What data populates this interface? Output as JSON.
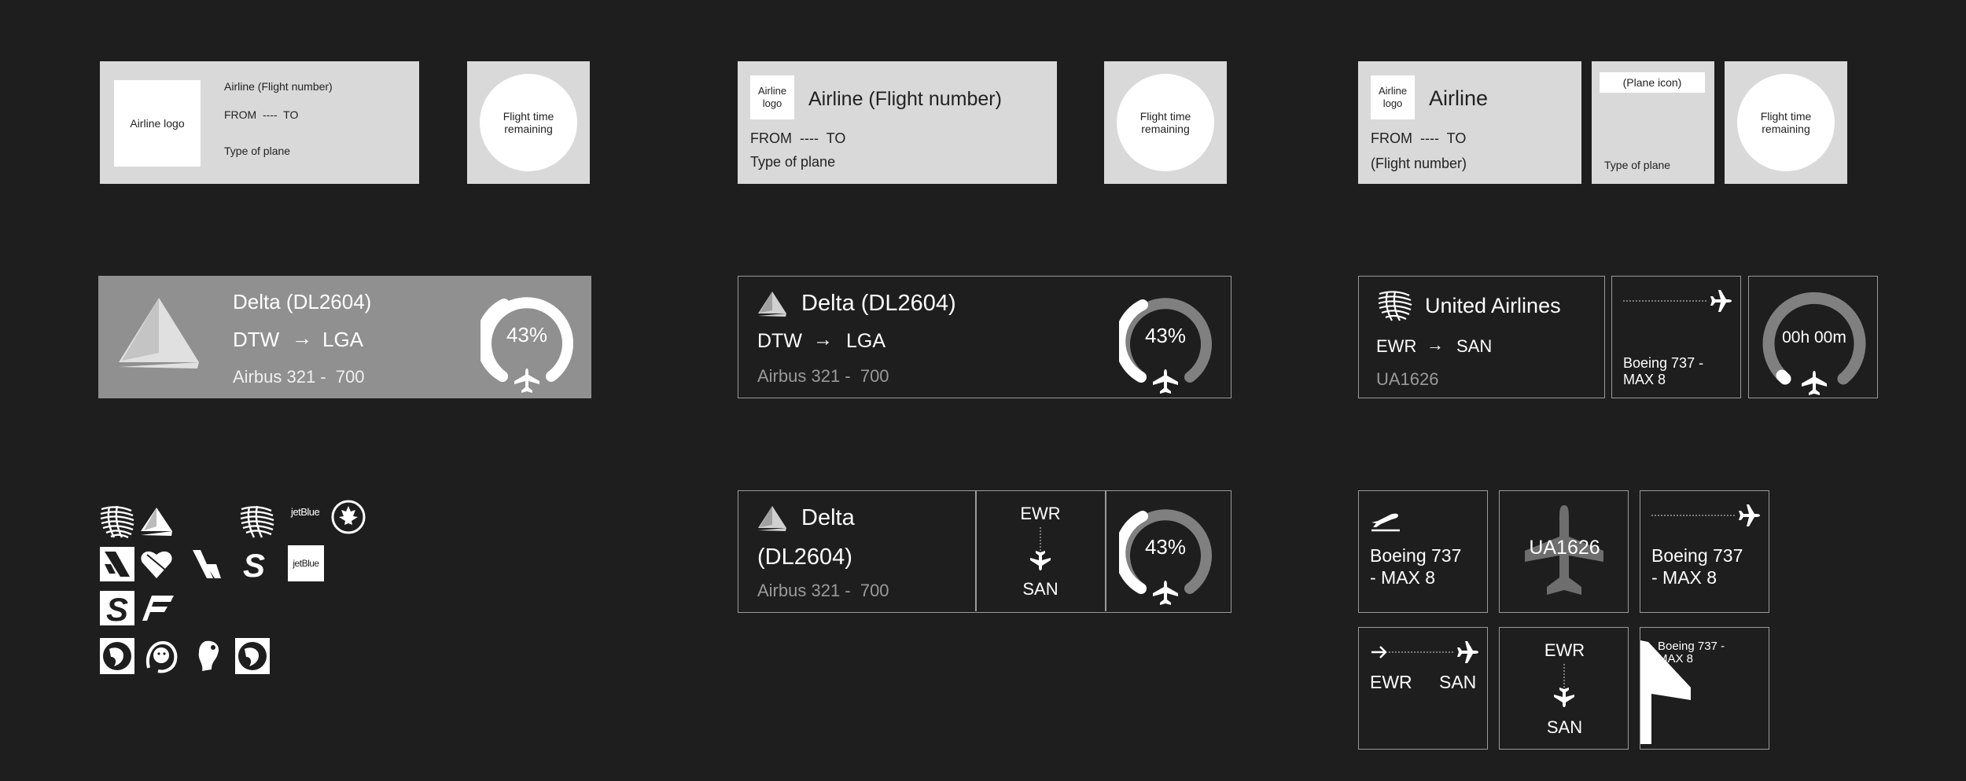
{
  "wireframe": {
    "a": {
      "logo": "Airline logo",
      "airline": "Airline (Flight number)",
      "route": "FROM  ----  TO",
      "plane": "Type of plane",
      "remaining": "Flight time remaining"
    },
    "b": {
      "logo": "Airline logo",
      "airline": "Airline (Flight number)",
      "route": "FROM  ----  TO",
      "plane": "Type of plane",
      "remaining": "Flight time remaining"
    },
    "c": {
      "logo": "Airline logo",
      "airline": "Airline",
      "route": "FROM  ----  TO",
      "flight_number": "(Flight number)",
      "plane_icon": "(Plane icon)",
      "plane": "Type of plane",
      "remaining": "Flight time remaining"
    }
  },
  "delta": {
    "title": "Delta  (DL2604)",
    "from": "DTW",
    "to": "LGA",
    "plane": "Airbus 321 -  700",
    "progress_label": "43%",
    "progress": 0.43
  },
  "delta_split": {
    "line1": "Delta",
    "line2": "(DL2604)",
    "plane": "Airbus 321 -  700",
    "from": "EWR",
    "to": "SAN",
    "progress_label": "43%"
  },
  "united": {
    "name": "United Airlines",
    "from": "EWR",
    "to": "SAN",
    "flight": "UA1626",
    "plane": "Boeing 737 - MAX 8",
    "time_label": "00h 00m",
    "progress": 0.02
  },
  "tiles": {
    "plane_a": "Boeing 737 - MAX 8",
    "flight": "UA1626",
    "plane_b": "Boeing 737 - MAX 8",
    "from": "EWR",
    "to": "SAN",
    "from2": "EWR",
    "to2": "SAN",
    "plane_c": "Boeing 737 - MAX 8"
  },
  "logos": {
    "jetblue": "jetBlue"
  },
  "colors": {
    "background": "#1e1e1e",
    "wireframe": "#d9d9d9",
    "card_gray": "#909090",
    "border": "#9a9a9a",
    "muted_text": "#9a9a9a",
    "ring_track": "#808080"
  }
}
